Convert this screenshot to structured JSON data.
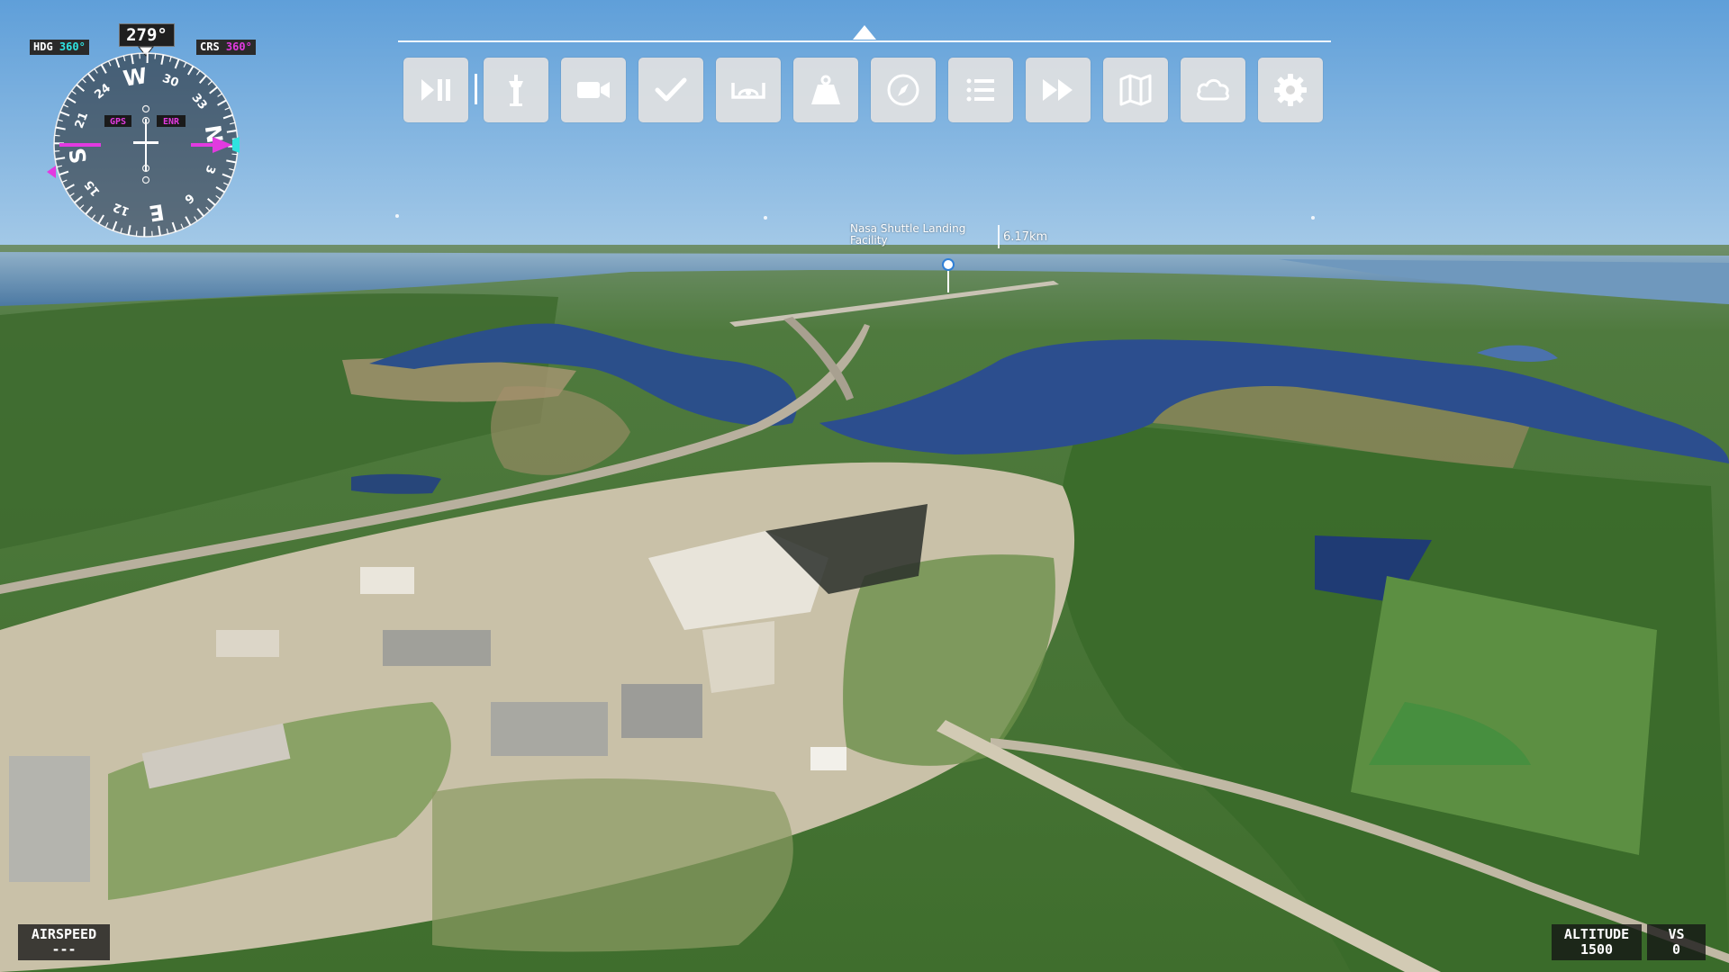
{
  "compass": {
    "heading_readout": "279°",
    "hdg_label": "HDG",
    "hdg_value": "360°",
    "crs_label": "CRS",
    "crs_value": "360°",
    "gps_label": "GPS",
    "enr_label": "ENR",
    "card_labels": [
      "W",
      "30",
      "33",
      "N",
      "3",
      "6",
      "E",
      "12",
      "15",
      "S",
      "21",
      "24"
    ],
    "heading_deg": 279,
    "colors": {
      "heading": "#2fe3e0",
      "course": "#e23ae0"
    }
  },
  "toolbar": {
    "buttons": [
      {
        "name": "pause-play-button",
        "icon": "play-pause-icon"
      },
      {
        "name": "atc-tower-button",
        "icon": "control-tower-icon"
      },
      {
        "name": "camera-button",
        "icon": "video-camera-icon"
      },
      {
        "name": "checklist-button",
        "icon": "check-icon"
      },
      {
        "name": "controls-button",
        "icon": "steering-icon"
      },
      {
        "name": "weight-balance-button",
        "icon": "weight-icon"
      },
      {
        "name": "navlog-button",
        "icon": "compass-icon"
      },
      {
        "name": "objectives-button",
        "icon": "list-icon"
      },
      {
        "name": "sim-rate-button",
        "icon": "fast-forward-icon"
      },
      {
        "name": "vfr-map-button",
        "icon": "map-icon"
      },
      {
        "name": "weather-button",
        "icon": "cloud-icon"
      },
      {
        "name": "settings-button",
        "icon": "gear-icon"
      }
    ]
  },
  "poi": {
    "label": "Nasa Shuttle Landing Facility",
    "distance": "6.17km"
  },
  "instruments": {
    "airspeed_label": "AIRSPEED",
    "airspeed_value": "---",
    "altitude_label": "ALTITUDE",
    "altitude_value": "1500",
    "vs_label": "VS",
    "vs_value": "0"
  }
}
